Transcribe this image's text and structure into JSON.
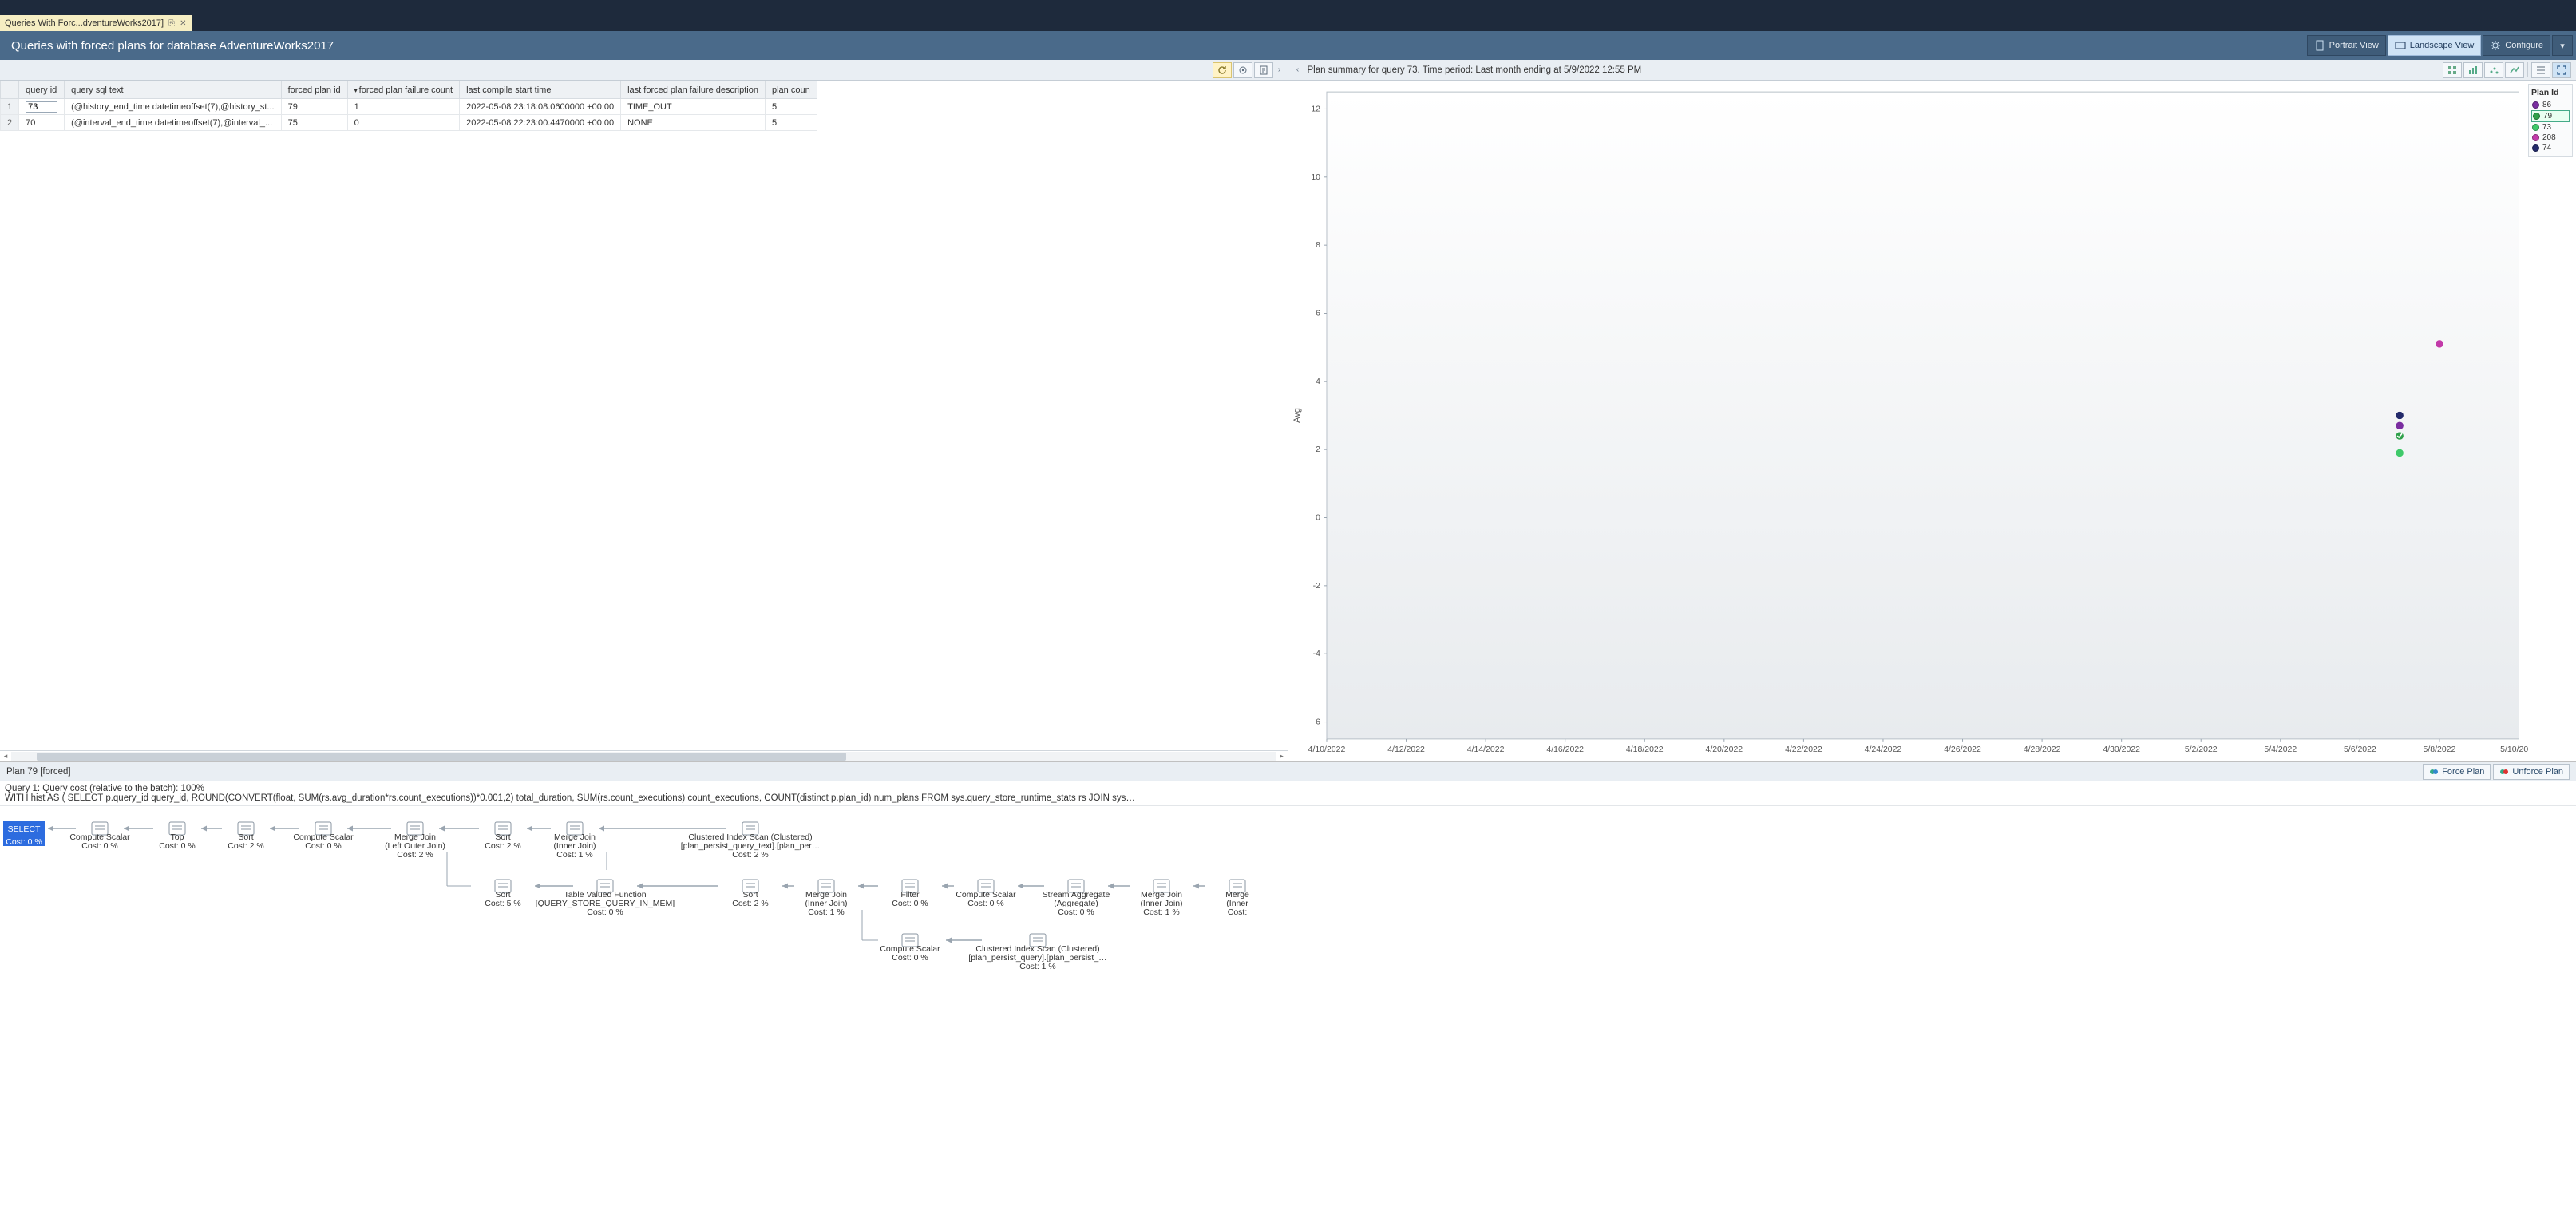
{
  "tab": {
    "title": "Queries With Forc...dventureWorks2017]"
  },
  "header": {
    "title": "Queries with forced plans for database AdventureWorks2017"
  },
  "view_buttons": {
    "portrait": "Portrait View",
    "landscape": "Landscape View",
    "configure": "Configure"
  },
  "grid": {
    "columns": [
      "query id",
      "query sql text",
      "forced plan id",
      "forced plan failure count",
      "last compile start time",
      "last forced plan failure description",
      "plan coun"
    ],
    "sorted_col_index": 3,
    "rows": [
      {
        "n": 1,
        "query_id": "73",
        "sql": "(@history_end_time datetimeoffset(7),@history_st...",
        "forced_plan_id": "79",
        "fail_count": "1",
        "last_compile": "2022-05-08 23:18:08.0600000 +00:00",
        "fail_desc": "TIME_OUT",
        "plan_count": "5"
      },
      {
        "n": 2,
        "query_id": "70",
        "sql": "(@interval_end_time datetimeoffset(7),@interval_...",
        "forced_plan_id": "75",
        "fail_count": "0",
        "last_compile": "2022-05-08 22:23:00.4470000 +00:00",
        "fail_desc": "NONE",
        "plan_count": "5"
      }
    ]
  },
  "chart": {
    "summary": "Plan summary for query 73. Time period: Last month ending at 5/9/2022 12:55 PM",
    "legend_title": "Plan Id",
    "legend": [
      {
        "id": "86",
        "color": "#7a2ea0"
      },
      {
        "id": "79",
        "color": "#2fa04a",
        "selected": true,
        "checkbox": true
      },
      {
        "id": "73",
        "color": "#3fc96a"
      },
      {
        "id": "208",
        "color": "#c23aa9"
      },
      {
        "id": "74",
        "color": "#232a6a"
      }
    ],
    "y_label": "Avg"
  },
  "chart_data": {
    "type": "scatter",
    "xlabel": "",
    "ylabel": "Avg",
    "x_ticks": [
      "4/10/2022",
      "4/12/2022",
      "4/14/2022",
      "4/16/2022",
      "4/18/2022",
      "4/20/2022",
      "4/22/2022",
      "4/24/2022",
      "4/26/2022",
      "4/28/2022",
      "4/30/2022",
      "5/2/2022",
      "5/4/2022",
      "5/6/2022",
      "5/8/2022",
      "5/10/2022"
    ],
    "y_ticks": [
      -6,
      -4,
      -2,
      0,
      2,
      4,
      6,
      8,
      10,
      12
    ],
    "ylim": [
      -6.5,
      12.5
    ],
    "series": [
      {
        "name": "208",
        "color": "#c23aa9",
        "points": [
          {
            "x": "5/8/2022",
            "y": 5.1
          }
        ]
      },
      {
        "name": "74",
        "color": "#232a6a",
        "points": [
          {
            "x": "5/7/2022",
            "y": 3.0
          }
        ]
      },
      {
        "name": "86",
        "color": "#7a2ea0",
        "points": [
          {
            "x": "5/7/2022",
            "y": 2.7
          }
        ]
      },
      {
        "name": "79",
        "color": "#2fa04a",
        "points": [
          {
            "x": "5/7/2022",
            "y": 2.4
          }
        ],
        "forced": true
      },
      {
        "name": "73",
        "color": "#3fc96a",
        "points": [
          {
            "x": "5/7/2022",
            "y": 1.9
          }
        ]
      }
    ]
  },
  "plan": {
    "title": "Plan 79 [forced]",
    "force_btn": "Force Plan",
    "unforce_btn": "Unforce Plan",
    "query_header": "Query 1: Query cost (relative to the batch): 100%",
    "query_text": "WITH hist AS ( SELECT p.query_id query_id, ROUND(CONVERT(float, SUM(rs.avg_duration*rs.count_executions))*0.001,2) total_duration, SUM(rs.count_executions) count_executions, COUNT(distinct p.plan_id) num_plans FROM sys.query_store_runtime_stats rs JOIN sys…",
    "nodes_row1": [
      {
        "id": "select",
        "lines": [
          "SELECT",
          "Cost: 0 %"
        ],
        "selected": true
      },
      {
        "id": "cs1",
        "lines": [
          "Compute Scalar",
          "Cost: 0 %"
        ]
      },
      {
        "id": "top",
        "lines": [
          "Top",
          "Cost: 0 %"
        ]
      },
      {
        "id": "sort1",
        "lines": [
          "Sort",
          "Cost: 2 %"
        ]
      },
      {
        "id": "cs2",
        "lines": [
          "Compute Scalar",
          "Cost: 0 %"
        ]
      },
      {
        "id": "mj1",
        "lines": [
          "Merge Join",
          "(Left Outer Join)",
          "Cost: 2 %"
        ]
      },
      {
        "id": "sort2",
        "lines": [
          "Sort",
          "Cost: 2 %"
        ]
      },
      {
        "id": "mj2",
        "lines": [
          "Merge Join",
          "(Inner Join)",
          "Cost: 1 %"
        ]
      },
      {
        "id": "cis1",
        "lines": [
          "Clustered Index Scan (Clustered)",
          "[plan_persist_query_text].[plan_per…",
          "Cost: 2 %"
        ]
      }
    ],
    "nodes_row2": [
      {
        "id": "sort3",
        "lines": [
          "Sort",
          "Cost: 5 %"
        ]
      },
      {
        "id": "tvf",
        "lines": [
          "Table Valued Function",
          "[QUERY_STORE_QUERY_IN_MEM]",
          "Cost: 0 %"
        ]
      },
      {
        "id": "sort4",
        "lines": [
          "Sort",
          "Cost: 2 %"
        ]
      },
      {
        "id": "mj3",
        "lines": [
          "Merge Join",
          "(Inner Join)",
          "Cost: 1 %"
        ]
      },
      {
        "id": "filter",
        "lines": [
          "Filter",
          "Cost: 0 %"
        ]
      },
      {
        "id": "cs3",
        "lines": [
          "Compute Scalar",
          "Cost: 0 %"
        ]
      },
      {
        "id": "sagg",
        "lines": [
          "Stream Aggregate",
          "(Aggregate)",
          "Cost: 0 %"
        ]
      },
      {
        "id": "mj4",
        "lines": [
          "Merge Join",
          "(Inner Join)",
          "Cost: 1 %"
        ]
      },
      {
        "id": "mergeClip",
        "lines": [
          "Merge",
          "(Inner",
          "Cost:"
        ]
      }
    ],
    "nodes_row3": [
      {
        "id": "cs4",
        "lines": [
          "Compute Scalar",
          "Cost: 0 %"
        ]
      },
      {
        "id": "cis2",
        "lines": [
          "Clustered Index Scan (Clustered)",
          "[plan_persist_query].[plan_persist_…",
          "Cost: 1 %"
        ]
      }
    ]
  }
}
